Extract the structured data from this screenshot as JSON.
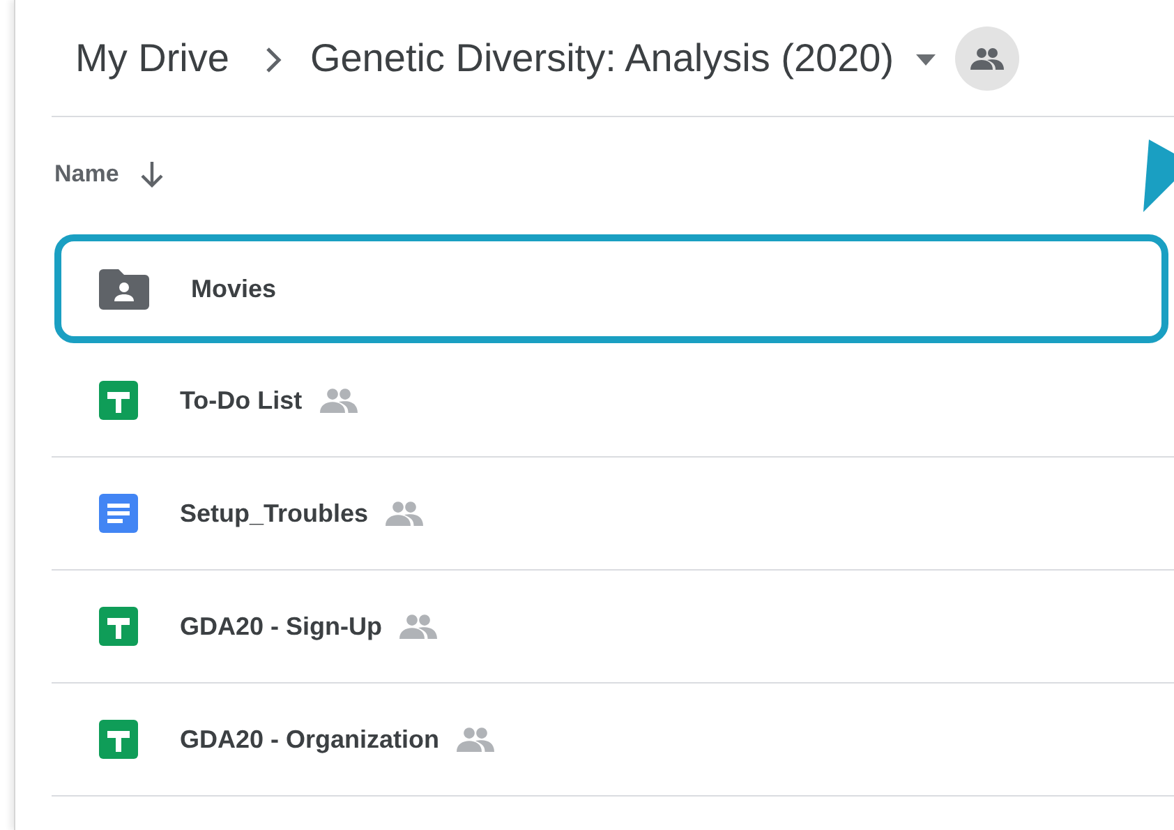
{
  "breadcrumb": {
    "root": "My Drive",
    "current": "Genetic Diversity: Analysis (2020)"
  },
  "list_header": {
    "label": "Name"
  },
  "files": [
    {
      "name": "Movies",
      "kind": "shared-folder",
      "shared": false,
      "highlighted": true
    },
    {
      "name": "To-Do List",
      "kind": "sheet",
      "shared": true,
      "highlighted": false
    },
    {
      "name": "Setup_Troubles",
      "kind": "doc",
      "shared": true,
      "highlighted": false
    },
    {
      "name": "GDA20 - Sign-Up",
      "kind": "sheet",
      "shared": true,
      "highlighted": false
    },
    {
      "name": "GDA20 - Organization",
      "kind": "sheet",
      "shared": true,
      "highlighted": false
    }
  ]
}
